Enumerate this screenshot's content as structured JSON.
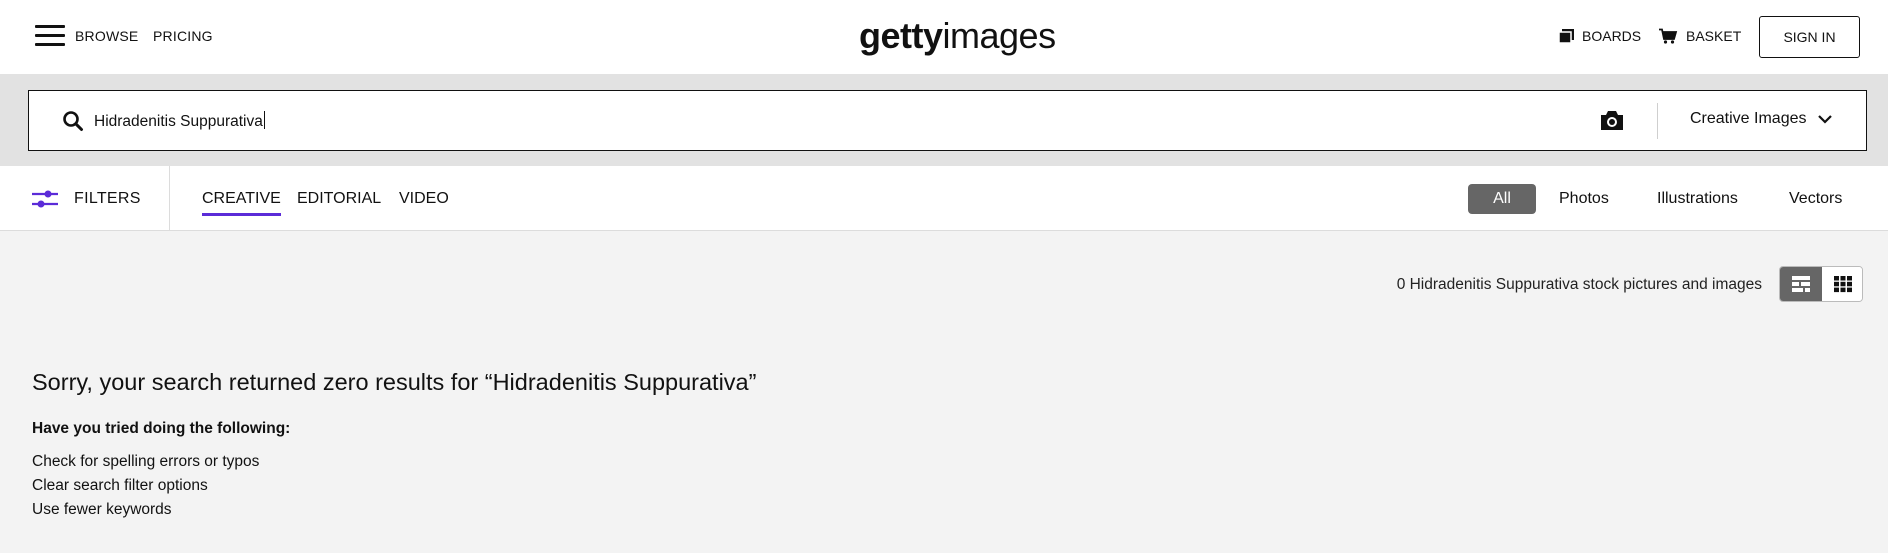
{
  "header": {
    "browse_label": "BROWSE",
    "pricing_label": "PRICING",
    "logo_bold": "getty",
    "logo_light": "images",
    "boards_label": "BOARDS",
    "basket_label": "BASKET",
    "signin_label": "SIGN IN",
    "icons": [
      "menu-icon",
      "boards-icon",
      "basket-icon"
    ]
  },
  "search": {
    "query": "Hidradenitis Suppurativa",
    "type_label": "Creative Images",
    "icons": [
      "search-icon",
      "camera-icon",
      "chevron-down-icon"
    ]
  },
  "filter_bar": {
    "filters_label": "FILTERS",
    "tabs": [
      {
        "label": "CREATIVE",
        "active": true
      },
      {
        "label": "EDITORIAL",
        "active": false
      },
      {
        "label": "VIDEO",
        "active": false
      }
    ],
    "media_types": [
      {
        "label": "All",
        "active": true
      },
      {
        "label": "Photos",
        "active": false
      },
      {
        "label": "Illustrations",
        "active": false
      },
      {
        "label": "Vectors",
        "active": false
      }
    ],
    "accent_color": "#5b2bd8"
  },
  "results": {
    "count_text": "0 Hidradenitis Suppurativa stock pictures and images",
    "view_modes": [
      "mosaic-view-icon",
      "grid-view-icon"
    ]
  },
  "empty_state": {
    "heading": "Sorry, your search returned zero results for “Hidradenitis Suppurativa”",
    "tried_label": "Have you tried doing the following:",
    "tips": [
      "Check for spelling errors or typos",
      "Clear search filter options",
      "Use fewer keywords"
    ]
  }
}
